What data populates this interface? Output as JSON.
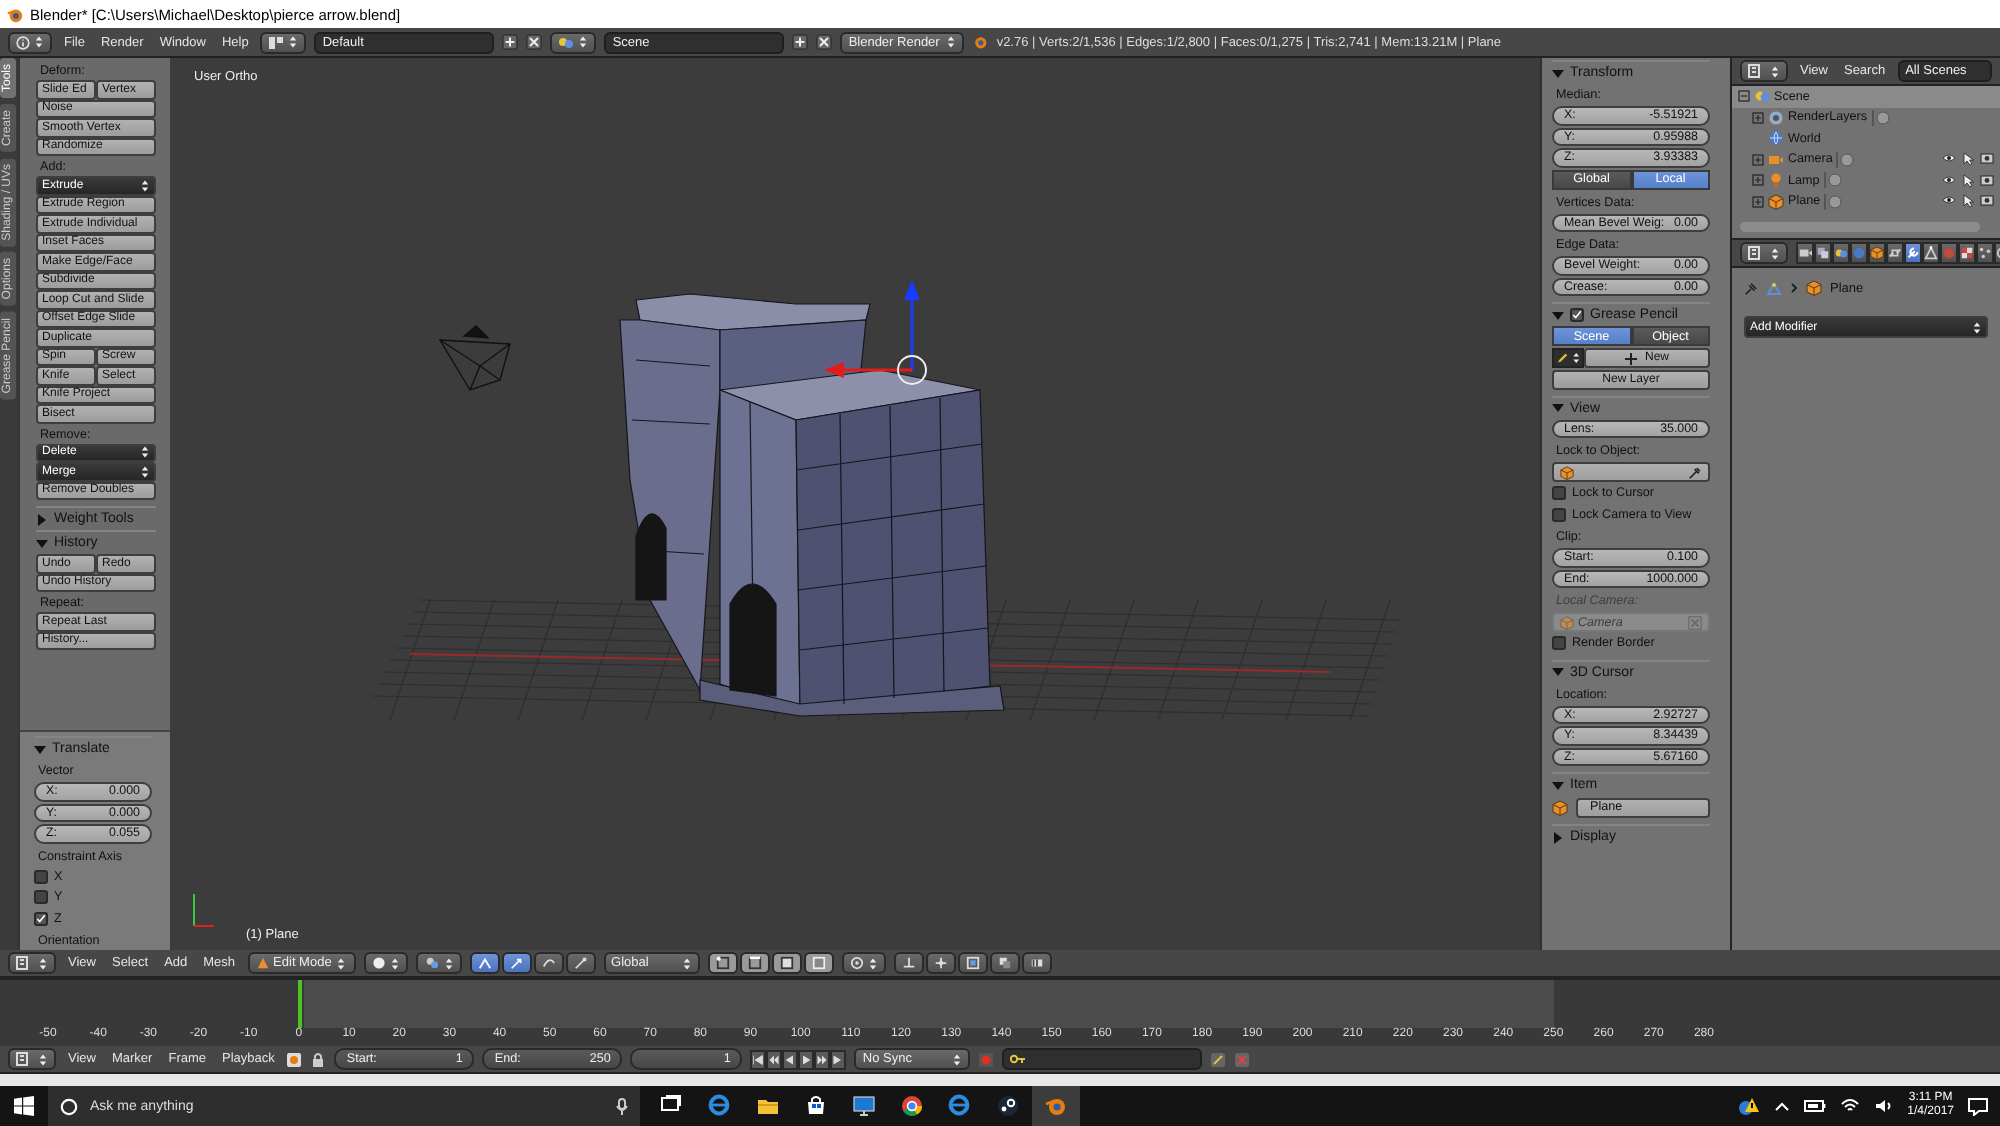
{
  "window": {
    "title": "Blender* [C:\\Users\\Michael\\Desktop\\pierce arrow.blend]"
  },
  "info_header": {
    "menus": [
      "File",
      "Render",
      "Window",
      "Help"
    ],
    "layout": "Default",
    "scene": "Scene",
    "engine": "Blender Render",
    "stats": "v2.76 | Verts:2/1,536 | Edges:1/2,800 | Faces:0/1,275 | Tris:2,741 | Mem:13.21M | Plane"
  },
  "tool_tabs": [
    {
      "label": "Tools",
      "selected": true
    },
    {
      "label": "Create",
      "selected": false
    },
    {
      "label": "Shading / UVs",
      "selected": false
    },
    {
      "label": "Options",
      "selected": false
    },
    {
      "label": "Grease Pencil",
      "selected": false
    }
  ],
  "tool_shelf": [
    {
      "items": [
        {
          "kind": "heading",
          "label": "Deform:"
        },
        {
          "kind": "pair",
          "labels": [
            "Slide Ed",
            "Vertex"
          ]
        },
        {
          "kind": "button",
          "label": "Noise"
        },
        {
          "kind": "button",
          "label": "Smooth Vertex"
        },
        {
          "kind": "button",
          "label": "Randomize"
        },
        {
          "kind": "heading",
          "label": "Add:"
        },
        {
          "kind": "dropdown",
          "label": "Extrude"
        },
        {
          "kind": "button",
          "label": "Extrude Region"
        },
        {
          "kind": "button",
          "label": "Extrude Individual"
        },
        {
          "kind": "button",
          "label": "Inset Faces"
        },
        {
          "kind": "button",
          "label": "Make Edge/Face"
        },
        {
          "kind": "button",
          "label": "Subdivide"
        },
        {
          "kind": "button",
          "label": "Loop Cut and Slide"
        },
        {
          "kind": "button",
          "label": "Offset Edge Slide"
        },
        {
          "kind": "button",
          "label": "Duplicate"
        },
        {
          "kind": "pair",
          "labels": [
            "Spin",
            "Screw"
          ]
        },
        {
          "kind": "pair",
          "labels": [
            "Knife",
            "Select"
          ]
        },
        {
          "kind": "button",
          "label": "Knife Project"
        },
        {
          "kind": "button",
          "label": "Bisect"
        },
        {
          "kind": "heading",
          "label": "Remove:"
        },
        {
          "kind": "dropdown",
          "label": "Delete"
        },
        {
          "kind": "dropdown",
          "label": "Merge"
        },
        {
          "kind": "button",
          "label": "Remove Doubles"
        }
      ]
    },
    {
      "title": "Weight Tools",
      "expanded": false
    },
    {
      "title": "History",
      "expanded": true,
      "items": [
        {
          "kind": "pair",
          "labels": [
            "Undo",
            "Redo"
          ]
        },
        {
          "kind": "button",
          "label": "Undo History"
        },
        {
          "kind": "heading",
          "label": "Repeat:"
        },
        {
          "kind": "button",
          "label": "Repeat Last"
        },
        {
          "kind": "button",
          "label": "History..."
        }
      ]
    }
  ],
  "operator_panel": {
    "title": "Translate",
    "expanded": true,
    "items": [
      {
        "kind": "heading",
        "label": "Vector"
      },
      {
        "kind": "number",
        "label": "X:",
        "value": "0.000"
      },
      {
        "kind": "number",
        "label": "Y:",
        "value": "0.000"
      },
      {
        "kind": "number",
        "label": "Z:",
        "value": "0.055"
      },
      {
        "kind": "heading",
        "label": "Constraint Axis"
      },
      {
        "kind": "checkbox",
        "label": "X",
        "checked": false
      },
      {
        "kind": "checkbox",
        "label": "Y",
        "checked": false
      },
      {
        "kind": "checkbox",
        "label": "Z",
        "checked": true
      },
      {
        "kind": "heading",
        "label": "Orientation"
      }
    ]
  },
  "viewport": {
    "view_name": "User Ortho",
    "object_label": "(1) Plane"
  },
  "properties_shelf": [
    {
      "title": "Transform",
      "expanded": true,
      "items": [
        {
          "kind": "heading",
          "label": "Median:"
        },
        {
          "kind": "number",
          "label": "X:",
          "value": "-5.51921"
        },
        {
          "kind": "number",
          "label": "Y:",
          "value": "0.95988"
        },
        {
          "kind": "number",
          "label": "Z:",
          "value": "3.93383"
        },
        {
          "kind": "toggle",
          "options": [
            {
              "label": "Global",
              "selected": false
            },
            {
              "label": "Local",
              "selected": true
            }
          ]
        },
        {
          "kind": "heading",
          "label": "Vertices Data:"
        },
        {
          "kind": "number",
          "label": "Mean Bevel Weig:",
          "value": "0.00"
        },
        {
          "kind": "heading",
          "label": "Edge Data:"
        },
        {
          "kind": "number",
          "label": "Bevel Weight:",
          "value": "0.00"
        },
        {
          "kind": "number",
          "label": "Crease:",
          "value": "0.00"
        }
      ]
    },
    {
      "title": "Grease Pencil",
      "expanded": true,
      "checked": true,
      "items": [
        {
          "kind": "toggle",
          "options": [
            {
              "label": "Scene",
              "selected": true
            },
            {
              "label": "Object",
              "selected": false
            }
          ]
        },
        {
          "kind": "new_row",
          "label": "New"
        },
        {
          "kind": "wide_button",
          "label": "New Layer"
        }
      ]
    },
    {
      "title": "View",
      "expanded": true,
      "items": [
        {
          "kind": "number",
          "label": "Lens:",
          "value": "35.000"
        },
        {
          "kind": "heading",
          "label": "Lock to Object:",
          "disabled": false
        },
        {
          "kind": "object_picker",
          "disabled": false
        },
        {
          "kind": "checkbox",
          "label": "Lock to Cursor",
          "checked": false
        },
        {
          "kind": "checkbox",
          "label": "Lock Camera to View",
          "checked": false
        },
        {
          "kind": "heading",
          "label": "Clip:",
          "disabled": false
        },
        {
          "kind": "number",
          "label": "Start:",
          "value": "0.100"
        },
        {
          "kind": "number",
          "label": "End:",
          "value": "1000.000"
        },
        {
          "kind": "heading",
          "label": "Local Camera:",
          "disabled": true
        },
        {
          "kind": "object_field",
          "value": "Camera",
          "disabled": true
        },
        {
          "kind": "checkbox",
          "label": "Render Border",
          "checked": false
        }
      ]
    },
    {
      "title": "3D Cursor",
      "expanded": true,
      "items": [
        {
          "kind": "heading",
          "label": "Location:"
        },
        {
          "kind": "number",
          "label": "X:",
          "value": "2.92727"
        },
        {
          "kind": "number",
          "label": "Y:",
          "value": "8.34439"
        },
        {
          "kind": "number",
          "label": "Z:",
          "value": "5.67160"
        }
      ]
    },
    {
      "title": "Item",
      "expanded": true,
      "items": [
        {
          "kind": "name_field",
          "value": "Plane"
        }
      ]
    },
    {
      "title": "Display",
      "expanded": false
    }
  ],
  "outliner": {
    "menus": [
      "View",
      "Search"
    ],
    "filter": "All Scenes",
    "tree": [
      {
        "kind": "scene",
        "name": "Scene",
        "selected": true,
        "expanded": true,
        "children": [
          {
            "kind": "render_layers",
            "name": "RenderLayers",
            "selected": false,
            "expanded": false
          },
          {
            "kind": "world",
            "name": "World",
            "selected": false
          },
          {
            "kind": "camera",
            "name": "Camera",
            "selected": false,
            "expanded": false
          },
          {
            "kind": "lamp",
            "name": "Lamp",
            "selected": false,
            "expanded": false
          },
          {
            "kind": "mesh",
            "name": "Plane",
            "selected": false,
            "expanded": false
          }
        ]
      }
    ]
  },
  "properties_editor": {
    "tabs": [
      {
        "kind": "render",
        "selected": false
      },
      {
        "kind": "layers",
        "selected": false
      },
      {
        "kind": "scene",
        "selected": false
      },
      {
        "kind": "world",
        "selected": false
      },
      {
        "kind": "object",
        "selected": false
      },
      {
        "kind": "constraints",
        "selected": false
      },
      {
        "kind": "modifiers",
        "selected": true
      },
      {
        "kind": "data",
        "selected": false
      },
      {
        "kind": "material",
        "selected": false
      },
      {
        "kind": "texture",
        "selected": false
      },
      {
        "kind": "particles",
        "selected": false
      },
      {
        "kind": "physics",
        "selected": false
      }
    ],
    "breadcrumb": "Plane",
    "add_modifier": "Add Modifier"
  },
  "view3d_header": {
    "menus": [
      "View",
      "Select",
      "Add",
      "Mesh"
    ],
    "mode": "Edit Mode",
    "widgets": [
      {
        "on": true
      },
      {
        "on": true
      },
      {
        "on": false
      },
      {
        "on": false
      }
    ],
    "orientation": "Global"
  },
  "timeline": {
    "ticks": [
      "-50",
      "-40",
      "-30",
      "-20",
      "-10",
      "0",
      "10",
      "20",
      "30",
      "40",
      "50",
      "60",
      "70",
      "80",
      "90",
      "100",
      "110",
      "120",
      "130",
      "140",
      "150",
      "160",
      "170",
      "180",
      "190",
      "200",
      "210",
      "220",
      "230",
      "240",
      "250",
      "260",
      "270",
      "280"
    ],
    "menus": [
      "View",
      "Marker",
      "Frame",
      "Playback"
    ],
    "start": {
      "label": "Start:",
      "value": "1"
    },
    "end": {
      "label": "End:",
      "value": "250"
    },
    "current_frame": "1",
    "sync": "No Sync"
  },
  "taskbar": {
    "search": {
      "placeholder": "Ask me anything"
    },
    "apps": [
      {
        "kind": "task_view",
        "active": false
      },
      {
        "kind": "edge",
        "active": false
      },
      {
        "kind": "explorer",
        "active": false
      },
      {
        "kind": "store",
        "active": false
      },
      {
        "kind": "monitor",
        "active": false
      },
      {
        "kind": "chrome",
        "active": false
      },
      {
        "kind": "edge",
        "active": false
      },
      {
        "kind": "steam",
        "active": false
      },
      {
        "kind": "blender",
        "active": true
      }
    ],
    "time": "3:11 PM",
    "date": "1/4/2017"
  }
}
